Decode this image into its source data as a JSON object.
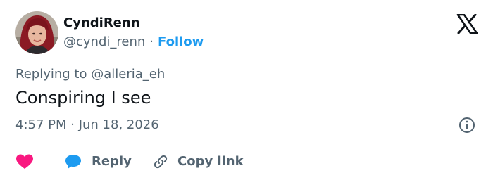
{
  "author": {
    "display_name": "CyndiRenn",
    "handle": "@cyndi_renn",
    "separator": "·",
    "follow_label": "Follow"
  },
  "reply_context": {
    "prefix": "Replying to",
    "mention": "@alleria_eh"
  },
  "tweet": {
    "text": "Conspiring I see",
    "timestamp": "4:57 PM · Jun 18, 2026"
  },
  "actions": {
    "reply_label": "Reply",
    "copy_link_label": "Copy link"
  },
  "colors": {
    "accent": "#1d9bf0",
    "heart": "#f91880",
    "muted": "#536471",
    "text": "#0f1419"
  },
  "icons": [
    "x-logo-icon",
    "info-icon",
    "heart-icon",
    "reply-bubble-icon",
    "link-icon"
  ]
}
